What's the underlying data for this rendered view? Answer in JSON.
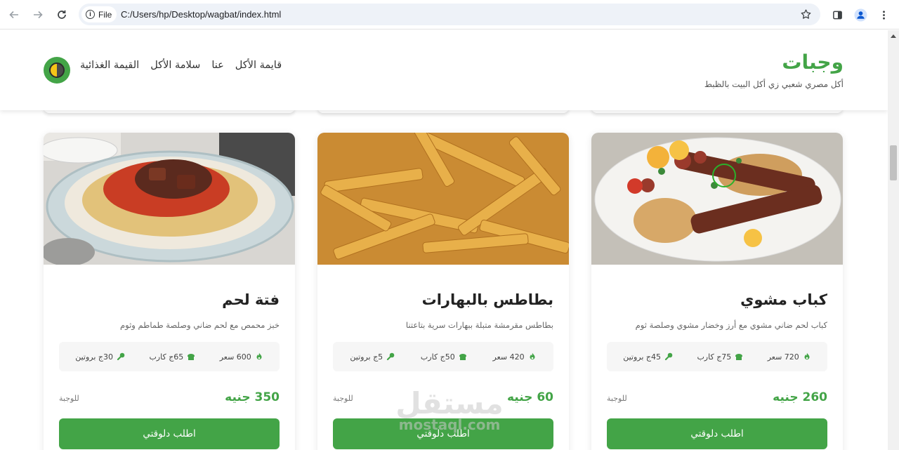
{
  "browser": {
    "scheme_label": "File",
    "url": "C:/Users/hp/Desktop/wagbat/index.html"
  },
  "header": {
    "brand_name": "وجبات",
    "tagline": "أكل مصري شعبي زي أكل البيت بالظبط",
    "nav": [
      {
        "label": "قايمة الأكل"
      },
      {
        "label": "عنا"
      },
      {
        "label": "سلامة الأكل"
      },
      {
        "label": "القيمة الغذائية"
      }
    ]
  },
  "cards": [
    {
      "title": "كباب مشوي",
      "description": "كباب لحم ضاني مشوي مع أرز وخضار مشوي وصلصة ثوم",
      "calories": "720 سعر",
      "carbs": "75ج كارب",
      "protein": "45ج بروتين",
      "price": "260 جنيه",
      "per": "للوجبة",
      "button": "اطلب دلوقتي"
    },
    {
      "title": "بطاطس بالبهارات",
      "description": "بطاطس مقرمشة متبلة ببهارات سرية بتاعتنا",
      "calories": "420 سعر",
      "carbs": "50ج كارب",
      "protein": "5ج بروتين",
      "price": "60 جنيه",
      "per": "للوجبة",
      "button": "اطلب دلوقتي"
    },
    {
      "title": "فتة لحم",
      "description": "خبز محمص مع لحم ضاني وصلصة طماطم وثوم",
      "calories": "600 سعر",
      "carbs": "65ج كارب",
      "protein": "30ج بروتين",
      "price": "350 جنيه",
      "per": "للوجبة",
      "button": "اطلب دلوقتي"
    }
  ],
  "watermark": {
    "arabic": "مستقل",
    "latin": "mostaql.com"
  },
  "colors": {
    "accent": "#43a447",
    "text": "#222222",
    "muted": "#666666",
    "stats_bg": "#f6f6f6"
  },
  "icons": {
    "calories": "fire-icon",
    "carbs": "bread-icon",
    "protein": "drumstick-icon"
  }
}
